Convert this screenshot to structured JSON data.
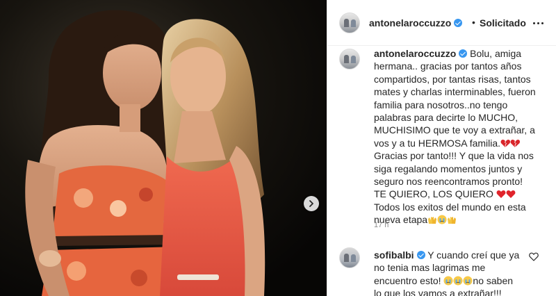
{
  "post": {
    "image": {
      "description": "photo-of-two-women",
      "carousel_next_icon": "chevron-right-icon"
    }
  },
  "header": {
    "username": "antonelaroccuzzo",
    "verified": true,
    "separator": "•",
    "follow_status": "Solicitado",
    "more_icon": "more-options-icon"
  },
  "caption": {
    "username": "antonelaroccuzzo",
    "lines": [
      "Bolu, amiga",
      "hermana.. gracias por tantos años",
      "compartidos, por tantas risas, tantos",
      "mates y charlas interminables, fueron",
      "familia para nosotros..no tengo",
      "palabras para decirte lo MUCHO,",
      "MUCHISIMO que te voy a extrañar, a",
      "vos y a tu HERMOSA familia.",
      "Gracias por tanto!!! Y que la vida nos",
      "siga regalando momentos juntos y",
      "seguro nos reencontramos pronto!",
      "TE QUIERO, LOS QUIERO",
      "Todos los exitos del mundo en esta",
      "nueva etapa"
    ],
    "time": "17 h"
  },
  "reply": {
    "username": "sofibalbi",
    "lines": [
      "Y cuando creí que ya",
      "no tenia mas lagrimas me",
      "encuentro esto!",
      "no saben",
      "lo que los vamos a extrañar!!!"
    ],
    "like_icon": "heart-outline-icon"
  },
  "colors": {
    "verified": "#3897f0",
    "text": "#262626",
    "muted": "#8e8e8e",
    "border": "#efefef"
  }
}
